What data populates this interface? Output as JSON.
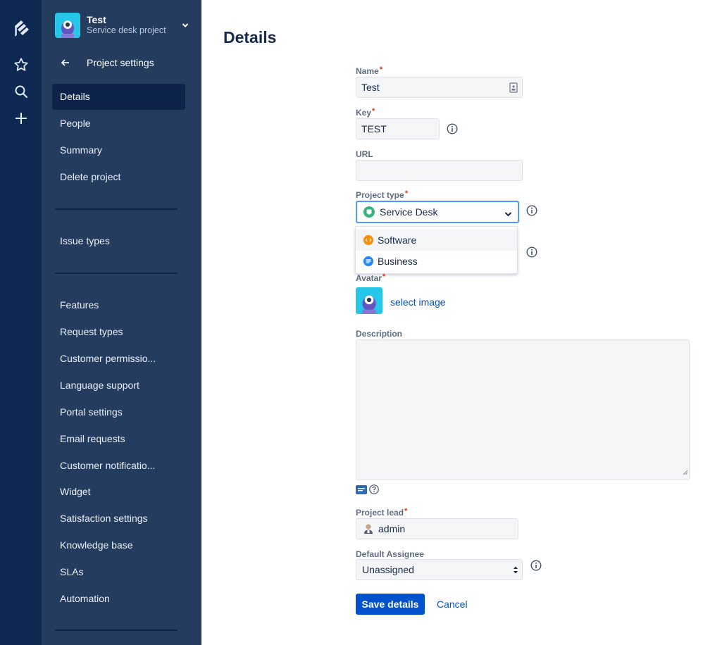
{
  "rail": {
    "icons": [
      "jira-logo-icon",
      "star-icon",
      "search-icon",
      "plus-icon"
    ]
  },
  "project": {
    "name": "Test",
    "type_label": "Service desk project"
  },
  "sidebar": {
    "back_label": "Project settings",
    "items": [
      {
        "label": "Details",
        "active": true
      },
      {
        "label": "People"
      },
      {
        "label": "Summary"
      },
      {
        "label": "Delete project"
      },
      {
        "label": "Issue types"
      },
      {
        "label": "Features"
      },
      {
        "label": "Request types"
      },
      {
        "label": "Customer permissio..."
      },
      {
        "label": "Language support"
      },
      {
        "label": "Portal settings"
      },
      {
        "label": "Email requests"
      },
      {
        "label": "Customer notificatio..."
      },
      {
        "label": "Widget"
      },
      {
        "label": "Satisfaction settings"
      },
      {
        "label": "Knowledge base"
      },
      {
        "label": "SLAs"
      },
      {
        "label": "Automation"
      }
    ]
  },
  "page": {
    "title": "Details"
  },
  "form": {
    "name": {
      "label": "Name",
      "value": "Test"
    },
    "key": {
      "label": "Key",
      "value": "TEST"
    },
    "url": {
      "label": "URL",
      "value": ""
    },
    "project_type": {
      "label": "Project type",
      "selected": "Service Desk",
      "options": [
        "Software",
        "Business"
      ]
    },
    "avatar": {
      "label": "Avatar",
      "link": "select image"
    },
    "description": {
      "label": "Description",
      "value": ""
    },
    "project_lead": {
      "label": "Project lead",
      "value": "admin"
    },
    "default_assignee": {
      "label": "Default Assignee",
      "selected": "Unassigned"
    },
    "required_mark": "*"
  },
  "actions": {
    "save_label": "Save details",
    "cancel_label": "Cancel"
  },
  "colors": {
    "rail_bg": "#0e2951",
    "sidebar_bg": "#243c5e",
    "primary": "#0052cc",
    "service_desk_green": "#36b37e",
    "software_orange": "#ff8b00",
    "business_blue": "#2684ff"
  }
}
